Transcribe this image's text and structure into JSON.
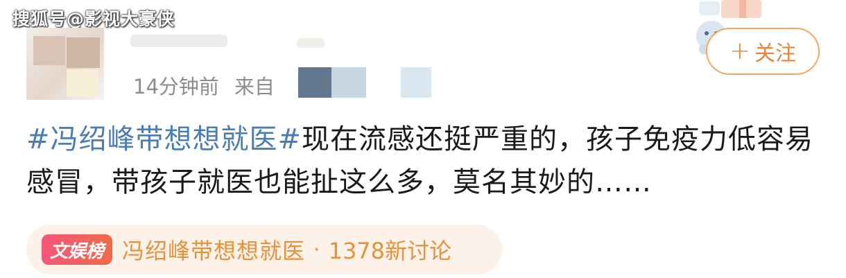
{
  "watermark": "搜狐号@影视大豪侠",
  "post": {
    "time": "14分钟前",
    "source_label": "来自"
  },
  "follow_button": {
    "label": "关注"
  },
  "content": {
    "hashtag": "#冯绍峰带想想就医#",
    "text": "现在流感还挺严重的，孩子免疫力低容易感冒，带孩子就医也能扯这么多，莫名其妙的……"
  },
  "topic": {
    "badge": "文娱榜",
    "name": "冯绍峰带想想就医",
    "separator": "·",
    "count": "1378新讨论"
  },
  "colors": {
    "hashtag": "#4a7cb8",
    "follow": "#e8833a",
    "topic": "#e8913a",
    "pill_bg": "#fdf2e9"
  },
  "icons": [
    "plus-icon",
    "decoration-sticker"
  ]
}
